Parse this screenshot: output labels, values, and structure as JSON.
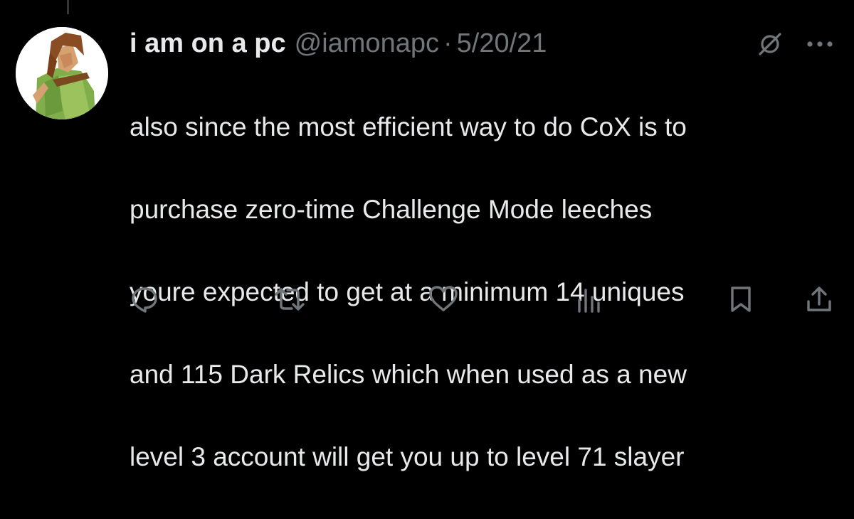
{
  "tweet": {
    "display_name": "i am on a pc",
    "handle": "@iamonapc",
    "separator": "·",
    "date": "5/20/21",
    "lines": [
      "also since the most efficient way to do CoX is to",
      "purchase zero-time Challenge Mode leeches",
      "youre expected to get at a minimum 14 uniques",
      "and 115 Dark Relics which when used as a new",
      "level 3 account will get you up to level 71 slayer"
    ]
  },
  "header_icons": [
    "grok-icon",
    "more-icon"
  ],
  "actions": [
    "reply-icon",
    "retweet-icon",
    "like-icon",
    "views-icon",
    "bookmark-icon",
    "share-icon"
  ],
  "colors": {
    "background": "#000000",
    "text_primary": "#e7e9ea",
    "text_secondary": "#71767b",
    "icon": "#71767b"
  }
}
